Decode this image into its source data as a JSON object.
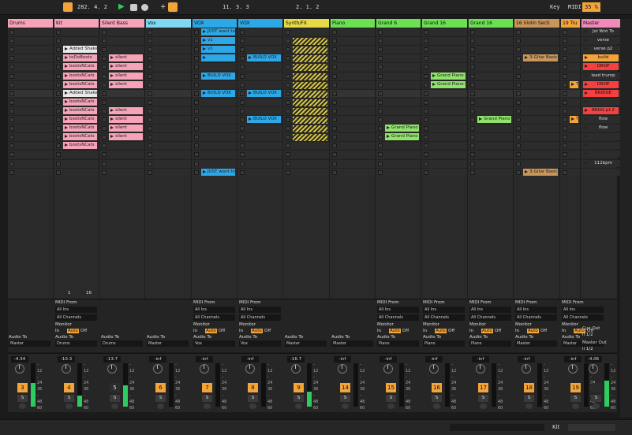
{
  "transport": {
    "position": "282. 4. 2",
    "tempo_pos": "11. 3. 3",
    "loop": "2. 1. 2",
    "key_label": "Key",
    "midi_label": "MIDI",
    "cpu": "35 %"
  },
  "tracks": [
    {
      "name": "Drums",
      "color": "#f6a3b8",
      "w": 58,
      "kind": "audio"
    },
    {
      "name": "Kit",
      "color": "#f6a3b8",
      "w": 57,
      "kind": "midi"
    },
    {
      "name": "Silent Bass",
      "color": "#f6a3b8",
      "w": 57,
      "kind": "audio"
    },
    {
      "name": "Vox",
      "color": "#7fd7f0",
      "w": 58,
      "kind": "audio"
    },
    {
      "name": "VOX",
      "color": "#2ea7e6",
      "w": 57,
      "kind": "midi"
    },
    {
      "name": "VOX",
      "color": "#2ea7e6",
      "w": 57,
      "kind": "midi"
    },
    {
      "name": "Synth/FX",
      "color": "#e6db45",
      "w": 58,
      "kind": "audio"
    },
    {
      "name": "Piano",
      "color": "#6be052",
      "w": 57,
      "kind": "audio"
    },
    {
      "name": "Grand 6",
      "color": "#6be052",
      "w": 57,
      "kind": "midi"
    },
    {
      "name": "Grand 16",
      "color": "#6be052",
      "w": 58,
      "kind": "midi"
    },
    {
      "name": "Grand 16",
      "color": "#6be052",
      "w": 57,
      "kind": "midi"
    },
    {
      "name": "16 Violin Secti",
      "color": "#c8955a",
      "w": 58,
      "kind": "midi"
    },
    {
      "name": "19 Tru",
      "color": "#f2a33a",
      "w": 25,
      "kind": "midi"
    },
    {
      "name": "Master",
      "color": "#f08ab8",
      "w": 58,
      "kind": "master"
    }
  ],
  "clips": [
    {
      "t": 1,
      "r": 2,
      "label": "Added Shaker",
      "c": "#e9e9e9"
    },
    {
      "t": 1,
      "r": 3,
      "label": "toDoBoots",
      "c": "#f6a3b8"
    },
    {
      "t": 1,
      "r": 4,
      "label": "bootsNCats",
      "c": "#f6a3b8"
    },
    {
      "t": 1,
      "r": 5,
      "label": "bootsNCats",
      "c": "#f6a3b8"
    },
    {
      "t": 1,
      "r": 6,
      "label": "bootsNCats",
      "c": "#f6a3b8"
    },
    {
      "t": 1,
      "r": 7,
      "label": "Added Shaker",
      "c": "#e9e9e9"
    },
    {
      "t": 1,
      "r": 8,
      "label": "bootsNCats",
      "c": "#f6a3b8"
    },
    {
      "t": 1,
      "r": 9,
      "label": "bootsNCats",
      "c": "#f6a3b8"
    },
    {
      "t": 1,
      "r": 10,
      "label": "bootsNCats",
      "c": "#f6a3b8"
    },
    {
      "t": 1,
      "r": 11,
      "label": "bootsNCats",
      "c": "#f6a3b8"
    },
    {
      "t": 1,
      "r": 12,
      "label": "bootsNCats",
      "c": "#f6a3b8"
    },
    {
      "t": 1,
      "r": 13,
      "label": "bootsNCats",
      "c": "#f6a3b8"
    },
    {
      "t": 2,
      "r": 3,
      "label": "silent",
      "c": "#f6a3b8"
    },
    {
      "t": 2,
      "r": 4,
      "label": "silent",
      "c": "#f6a3b8"
    },
    {
      "t": 2,
      "r": 5,
      "label": "silent",
      "c": "#f6a3b8"
    },
    {
      "t": 2,
      "r": 6,
      "label": "silent",
      "c": "#f6a3b8"
    },
    {
      "t": 2,
      "r": 9,
      "label": "silent",
      "c": "#f6a3b8"
    },
    {
      "t": 2,
      "r": 10,
      "label": "silent",
      "c": "#f6a3b8"
    },
    {
      "t": 2,
      "r": 11,
      "label": "silent",
      "c": "#f6a3b8"
    },
    {
      "t": 2,
      "r": 12,
      "label": "silent",
      "c": "#f6a3b8"
    },
    {
      "t": 4,
      "r": 0,
      "label": "JUST want to",
      "c": "#2ea7e6"
    },
    {
      "t": 4,
      "r": 1,
      "label": "v1",
      "c": "#2ea7e6"
    },
    {
      "t": 4,
      "r": 2,
      "label": "v1",
      "c": "#2ea7e6"
    },
    {
      "t": 4,
      "r": 3,
      "label": "",
      "c": "#2ea7e6"
    },
    {
      "t": 4,
      "r": 5,
      "label": "BUILD VOX",
      "c": "#2ea7e6"
    },
    {
      "t": 4,
      "r": 7,
      "label": "BUILD VOX",
      "c": "#2ea7e6"
    },
    {
      "t": 4,
      "r": 16,
      "label": "JUST want to",
      "c": "#2ea7e6"
    },
    {
      "t": 5,
      "r": 3,
      "label": "BUILD VOX",
      "c": "#2ea7e6"
    },
    {
      "t": 5,
      "r": 7,
      "label": "BUILD VOX",
      "c": "#2ea7e6"
    },
    {
      "t": 5,
      "r": 10,
      "label": "BUILD VOX",
      "c": "#2ea7e6"
    },
    {
      "t": 8,
      "r": 11,
      "label": "Grand Piano St",
      "c": "#8fe26a"
    },
    {
      "t": 8,
      "r": 12,
      "label": "Grand Piano St",
      "c": "#8fe26a"
    },
    {
      "t": 9,
      "r": 5,
      "label": "Grand Piano St",
      "c": "#8fe26a"
    },
    {
      "t": 9,
      "r": 6,
      "label": "Grand Piano St",
      "c": "#8fe26a"
    },
    {
      "t": 10,
      "r": 10,
      "label": "Grand Piano St",
      "c": "#8fe26a"
    },
    {
      "t": 11,
      "r": 3,
      "label": "3-Gitar Basic 2",
      "c": "#c8955a"
    },
    {
      "t": 11,
      "r": 16,
      "label": "3-Gitar Basic 2",
      "c": "#c8955a"
    },
    {
      "t": 12,
      "r": 6,
      "label": "Tru",
      "c": "#f2a33a"
    },
    {
      "t": 12,
      "r": 10,
      "label": "Tru",
      "c": "#f2a33a"
    }
  ],
  "scenes": [
    {
      "label": "Jst Wnt To",
      "n": "1"
    },
    {
      "label": "verse",
      "n": "2"
    },
    {
      "label": "verse p2",
      "n": "3"
    },
    {
      "label": "build",
      "n": "4",
      "c": "#f2a33a"
    },
    {
      "label": "DROP",
      "n": "5",
      "c": "#f54040"
    },
    {
      "label": "lead trump",
      "n": "6"
    },
    {
      "label": "DROP",
      "n": "7",
      "c": "#f54040"
    },
    {
      "label": "BRIDGE",
      "n": "8",
      "c": "#f54040"
    },
    {
      "label": "",
      "n": "9"
    },
    {
      "label": "BRDG pt 2",
      "n": "10",
      "c": "#f54040"
    },
    {
      "label": "flow",
      "n": "11"
    },
    {
      "label": "flow",
      "n": "12"
    },
    {
      "label": "",
      "n": "13"
    },
    {
      "label": "",
      "n": "14"
    },
    {
      "label": "",
      "n": "15"
    },
    {
      "label": "112bpm",
      "n": "16"
    }
  ],
  "io": {
    "midi_from": "MIDI From",
    "all_ins": "All Ins",
    "all_channels": "All Channels",
    "monitor": "Monitor",
    "in": "In",
    "auto": "Auto",
    "off": "Off",
    "audio_to": "Audio To",
    "master": "Master",
    "cue_out": "Cue Out",
    "cue_val": "ii 1/2",
    "master_out": "Master Out",
    "master_val": "ii 1/2"
  },
  "routing": [
    "Master",
    "Drums",
    "Drums",
    "Master",
    "Vox",
    "Vox",
    "Master",
    "Master",
    "Piano",
    "Piano",
    "Piano",
    "Master",
    "Master",
    "Master"
  ],
  "volumes": [
    "-4.34",
    "-10.3",
    "-13.7",
    "-inf",
    "-inf",
    "-inf",
    "-16.7",
    "-inf",
    "-inf",
    "-inf",
    "-inf",
    "-inf",
    "-inf",
    "-4.06"
  ],
  "meters": [
    0.55,
    0.25,
    0.5,
    0,
    0,
    0,
    0.35,
    0,
    0,
    0,
    0,
    0,
    0,
    0.6
  ],
  "numbers": [
    "3",
    "4",
    "5",
    "6",
    "7",
    "8",
    "9",
    "14",
    "15",
    "16",
    "17",
    "18",
    "19",
    ""
  ],
  "scale": [
    "-",
    "12",
    "-",
    "24",
    "36",
    "-",
    "48",
    "60"
  ],
  "kit_status": {
    "a": "1",
    "b": "16"
  },
  "bottom": {
    "label": "Kit"
  }
}
